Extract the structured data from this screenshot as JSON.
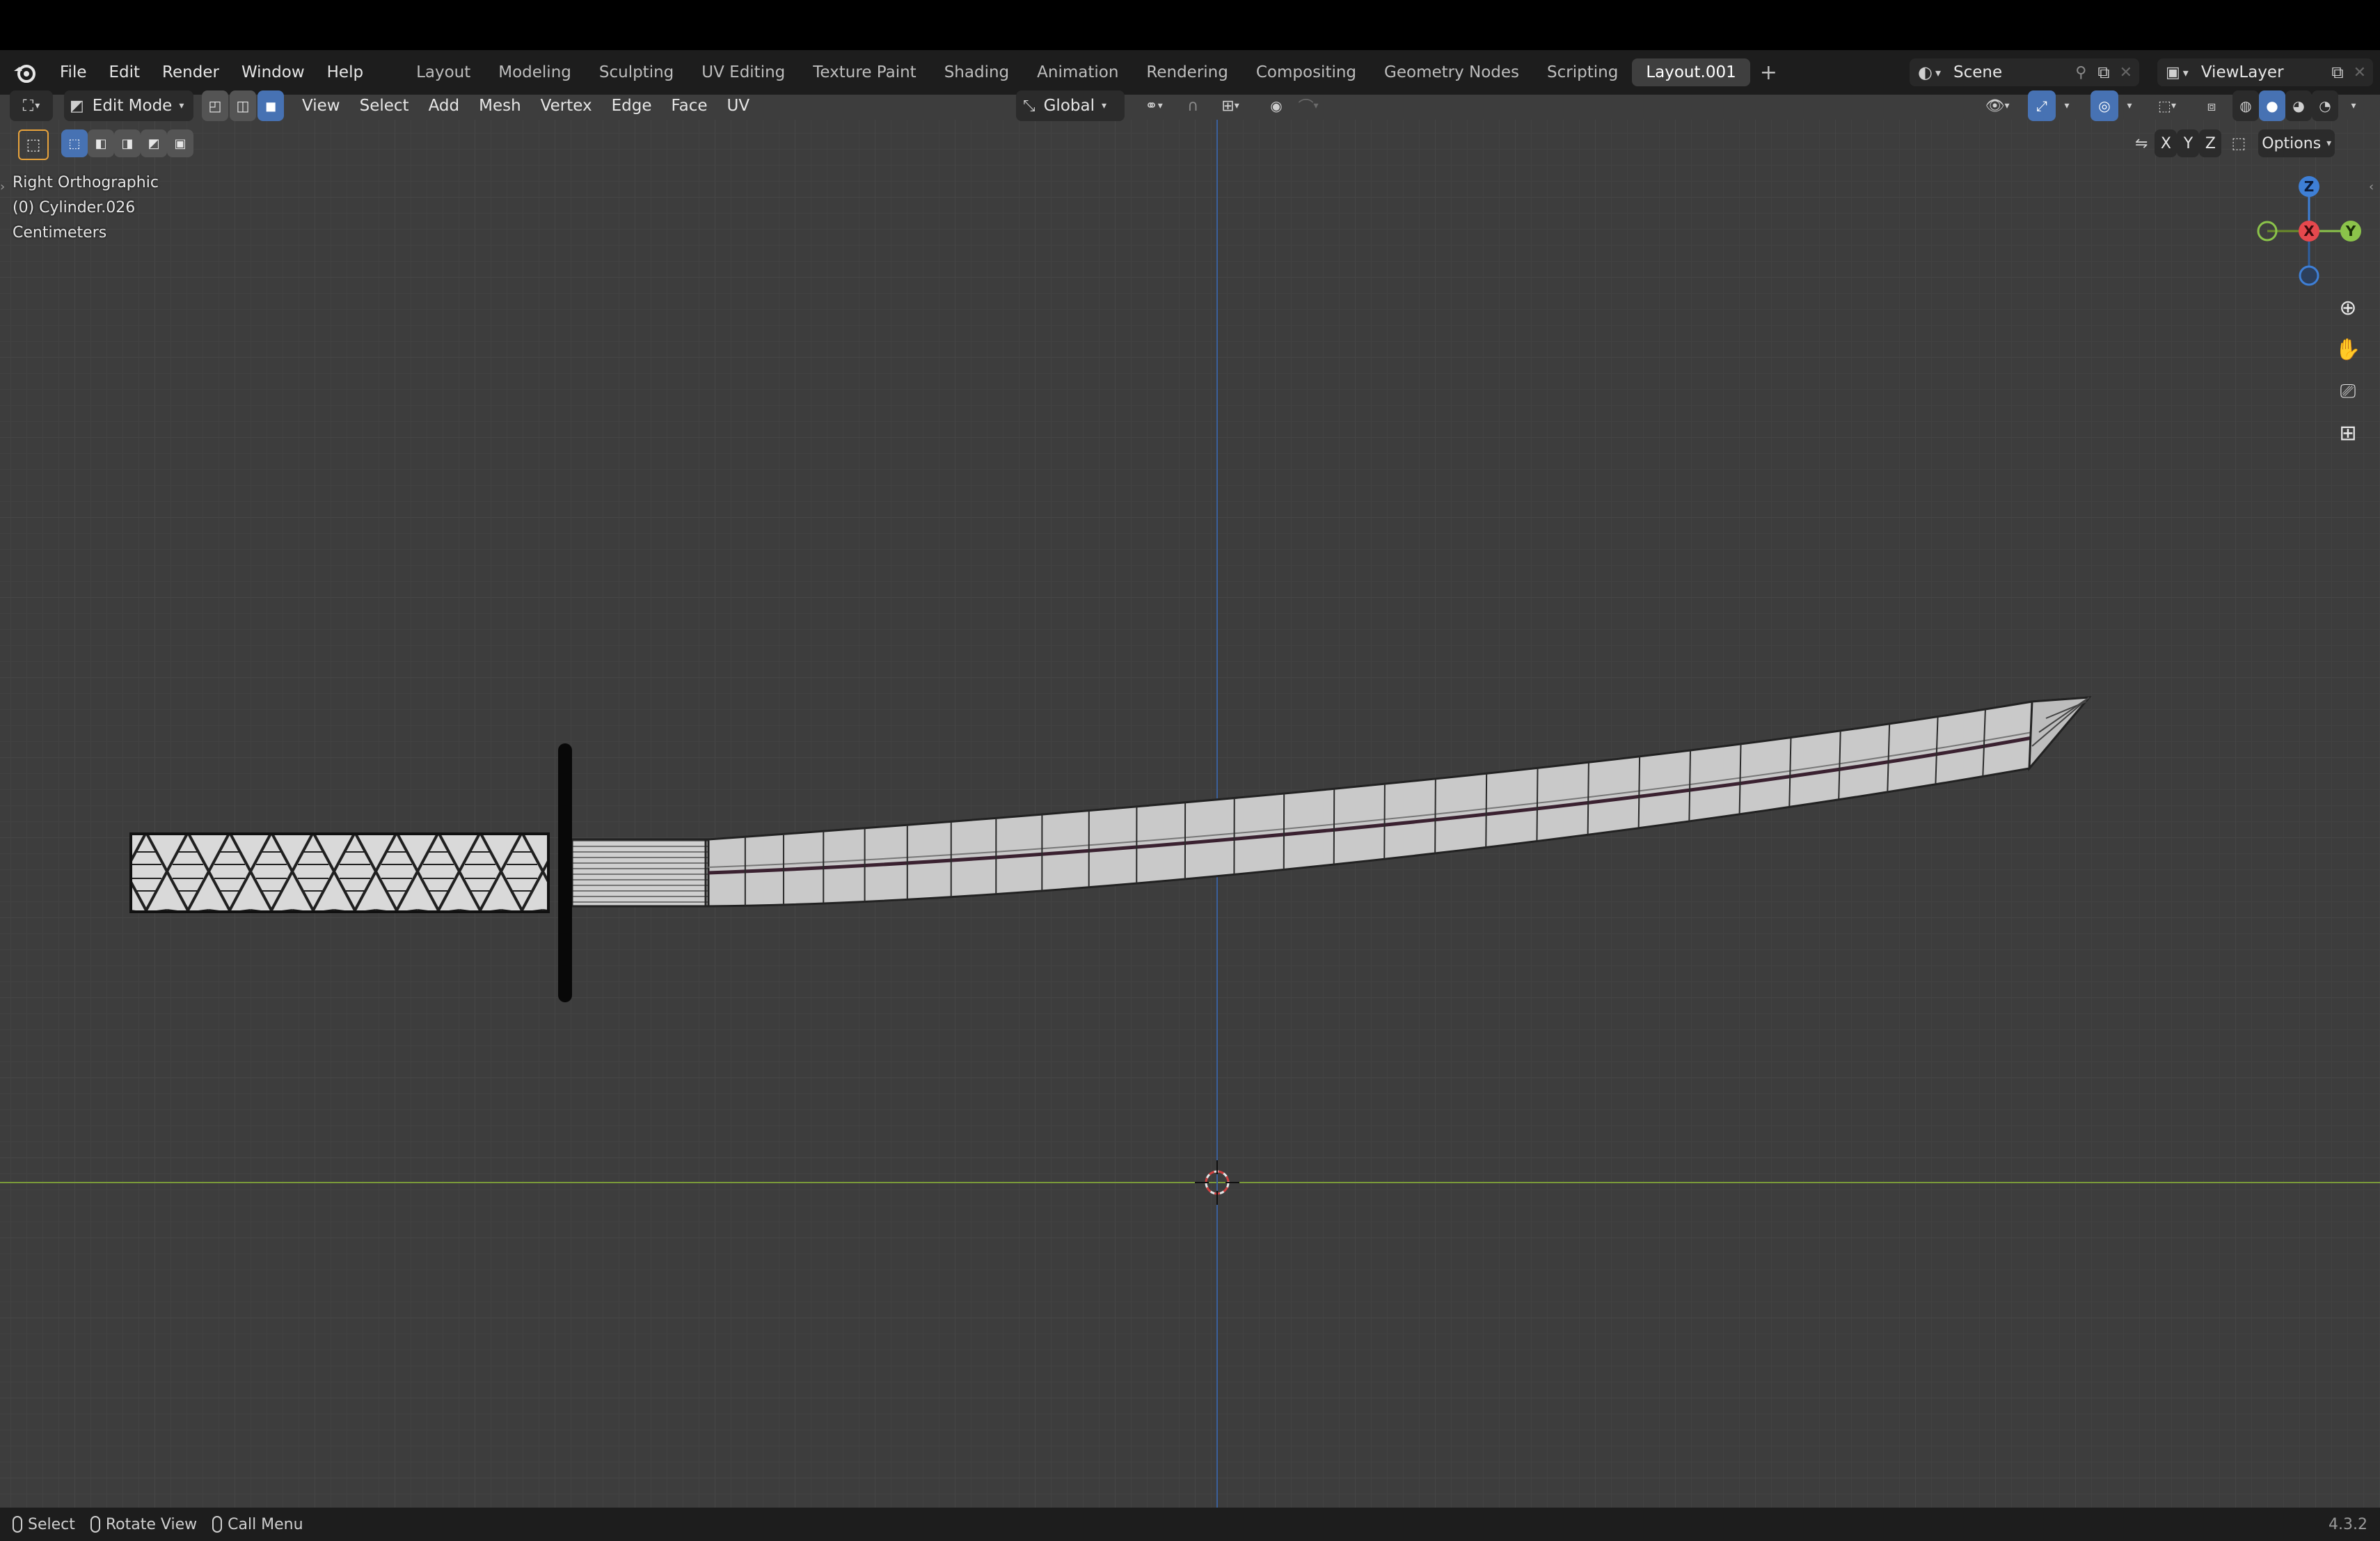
{
  "app": {
    "menus": [
      "File",
      "Edit",
      "Render",
      "Window",
      "Help"
    ],
    "workspaces": [
      "Layout",
      "Modeling",
      "Sculpting",
      "UV Editing",
      "Texture Paint",
      "Shading",
      "Animation",
      "Rendering",
      "Compositing",
      "Geometry Nodes",
      "Scripting",
      "Layout.001"
    ],
    "active_workspace": "Layout.001",
    "scene_name": "Scene",
    "view_layer": "ViewLayer",
    "version": "4.3.2"
  },
  "header": {
    "mode": "Edit Mode",
    "menus": [
      "View",
      "Select",
      "Add",
      "Mesh",
      "Vertex",
      "Edge",
      "Face",
      "UV"
    ],
    "transform_orientation": "Global",
    "options_label": "Options",
    "axes": [
      "X",
      "Y",
      "Z"
    ]
  },
  "overlay": {
    "view_name": "Right Orthographic",
    "object_name": "(0) Cylinder.026",
    "units": "Centimeters"
  },
  "gizmo": {
    "z": "Z",
    "x": "X",
    "y": "Y"
  },
  "statusbar": {
    "select": "Select",
    "rotate": "Rotate View",
    "call_menu": "Call Menu"
  },
  "colors": {
    "x_axis": "#e5484d",
    "y_axis": "#8bc34a",
    "z_axis": "#3e7fd6",
    "accent": "#4772b3"
  }
}
